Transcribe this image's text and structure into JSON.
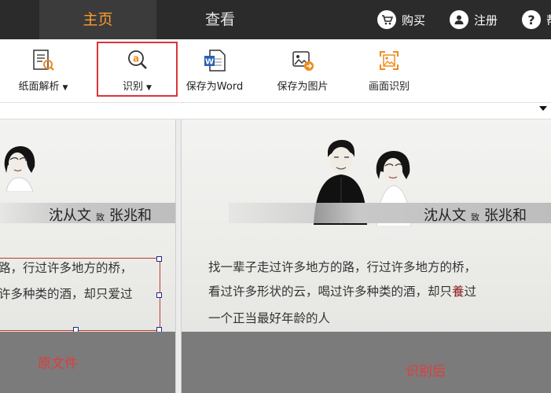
{
  "nav": {
    "tabs": [
      {
        "label": "主页",
        "active": true
      },
      {
        "label": "查看",
        "active": false
      }
    ],
    "actions": [
      {
        "label": "购买",
        "icon": "cart-icon"
      },
      {
        "label": "注册",
        "icon": "user-icon"
      },
      {
        "label": "帮",
        "icon": "help-icon"
      }
    ]
  },
  "toolbar": {
    "items": [
      {
        "label": "纸面解析",
        "icon": "document-analysis-icon",
        "has_dropdown": true
      },
      {
        "label": "识别",
        "icon": "recognize-icon",
        "has_dropdown": true,
        "highlighted": true
      },
      {
        "label": "保存为Word",
        "icon": "word-icon",
        "has_dropdown": false
      },
      {
        "label": "保存为图片",
        "icon": "save-image-icon",
        "has_dropdown": false
      },
      {
        "label": "画面识别",
        "icon": "screen-capture-icon",
        "has_dropdown": false
      }
    ]
  },
  "left_pane": {
    "names": {
      "a": "沈从文",
      "conn": "致",
      "b": "张兆和"
    },
    "lines": [
      "路，行过许多地方的桥，",
      "许多种类的酒，却只爱过"
    ],
    "caption": "原文件"
  },
  "right_pane": {
    "names": {
      "a": "沈从文",
      "conn": "致",
      "b": "张兆和"
    },
    "line1": "找一辈子走过许多地方的路，行过许多地方的桥，",
    "line2_before": "看过许多形状的云，喝过许多种类的酒，却只",
    "line2_error": "養",
    "line2_after": "过",
    "line3": "一个正当最好年龄的人",
    "caption": "识别后"
  },
  "colors": {
    "accent": "#ff9a2e",
    "highlight_border": "#d9353a",
    "caption": "#e23c3c",
    "topbar": "#2b2b2b",
    "error_char": "#8b1a1a"
  }
}
